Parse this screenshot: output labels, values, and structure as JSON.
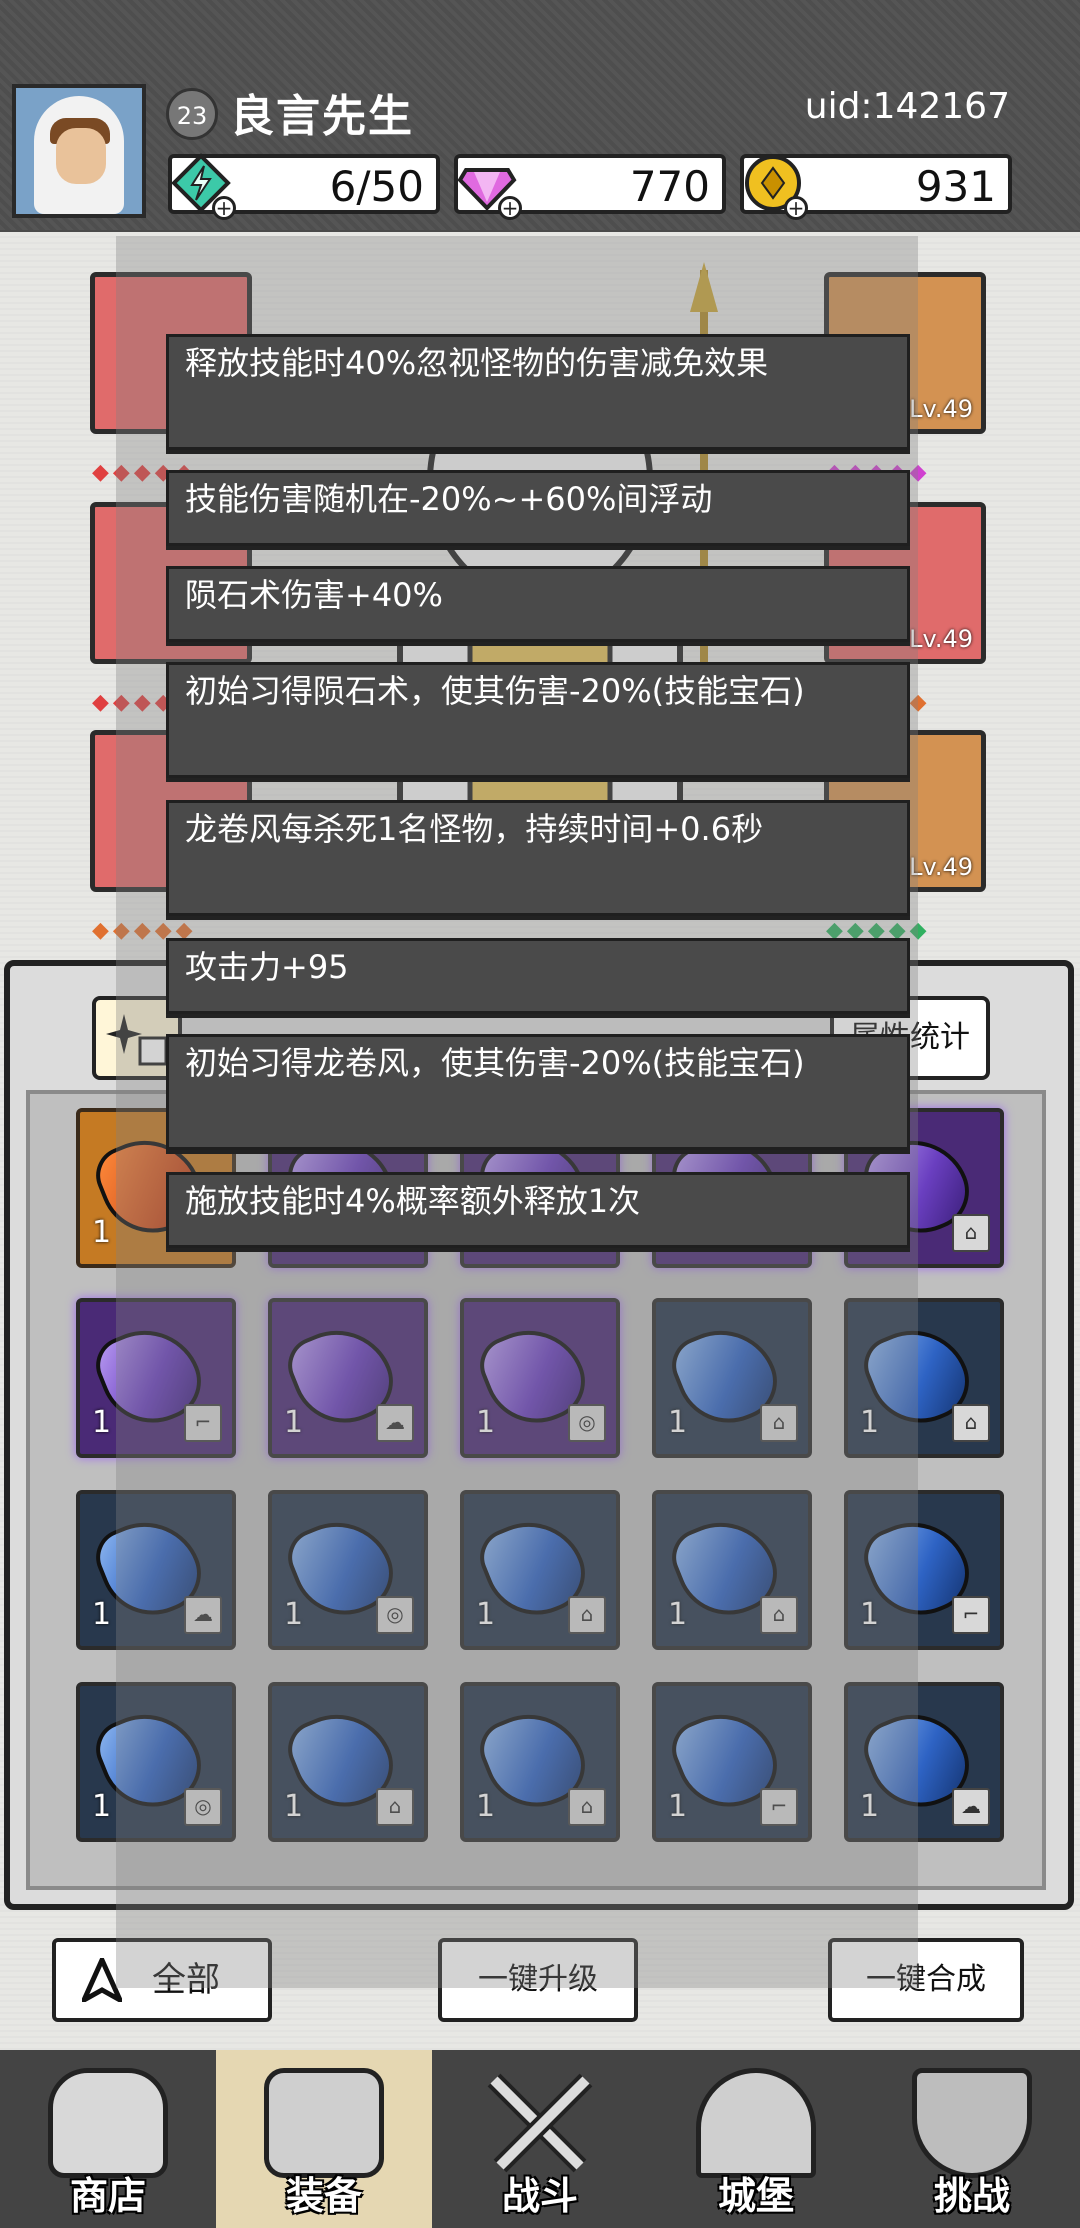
{
  "player": {
    "level": "23",
    "name": "良言先生",
    "uid": "uid:142167"
  },
  "resources": {
    "stamina": "6/50",
    "gems": "770",
    "gold": "931"
  },
  "equipment": {
    "right_levels": [
      "Lv.49",
      "Lv.49",
      "Lv.49"
    ]
  },
  "inventory": {
    "stats_label": "属性统计",
    "rows": [
      [
        {
          "color": "orange",
          "count": "1"
        },
        {
          "color": "purple",
          "count": ""
        },
        {
          "color": "purple",
          "count": ""
        },
        {
          "color": "purple",
          "count": ""
        },
        {
          "color": "purple",
          "count": ""
        }
      ],
      [
        {
          "color": "purple",
          "count": "1"
        },
        {
          "color": "purple",
          "count": "1"
        },
        {
          "color": "purple",
          "count": "1"
        },
        {
          "color": "blue",
          "count": "1"
        },
        {
          "color": "blue",
          "count": "1"
        }
      ],
      [
        {
          "color": "blue",
          "count": "1"
        },
        {
          "color": "blue",
          "count": "1"
        },
        {
          "color": "blue",
          "count": "1"
        },
        {
          "color": "blue",
          "count": "1"
        },
        {
          "color": "blue",
          "count": "1"
        }
      ],
      [
        {
          "color": "blue",
          "count": "1"
        },
        {
          "color": "blue",
          "count": "1"
        },
        {
          "color": "blue",
          "count": "1"
        },
        {
          "color": "blue",
          "count": "1"
        },
        {
          "color": "blue",
          "count": "1"
        }
      ]
    ]
  },
  "actions": {
    "filter_all": "全部",
    "upgrade_all": "一键升级",
    "merge_all": "一键合成"
  },
  "nav": {
    "shop": "商店",
    "equipment": "装备",
    "battle": "战斗",
    "castle": "城堡",
    "challenge": "挑战"
  },
  "tooltips": [
    "释放技能时40%忽视怪物的伤害减免效果",
    "技能伤害随机在-20%~+60%间浮动",
    "陨石术伤害+40%",
    "初始习得陨石术，使其伤害-20%(技能宝石)",
    "龙卷风每杀死1名怪物，持续时间+0.6秒",
    "攻击力+95",
    "初始习得龙卷风，使其伤害-20%(技能宝石)",
    "施放技能时4%概率额外释放1次"
  ],
  "colors": {
    "slot_red": "#e06b6b",
    "slot_orange": "#d39252",
    "gem_purple": "#4a2a76",
    "gem_blue": "#28384d",
    "tooltip_bg": "#4a4a4a"
  }
}
